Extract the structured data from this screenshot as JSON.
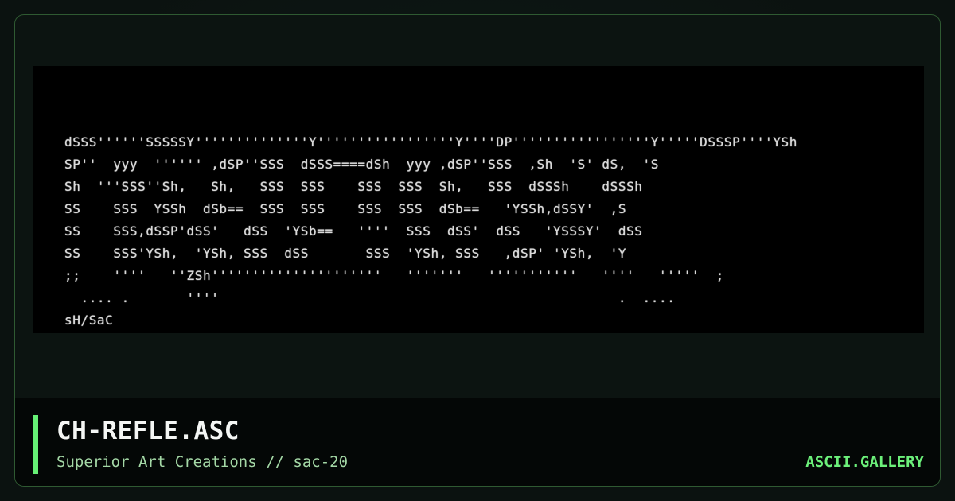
{
  "art": {
    "lines": [
      "dSSS''''''SSSSSY''''''''''''''Y'''''''''''''''''Y''''DP'''''''''''''''''Y'''''DSSSP''''YSh",
      "SP''  yyy  '''''' ,dSP''SSS  dSSS====dSh  yyy ,dSP''SSS  ,Sh  'S' dS,  'S",
      "Sh  '''SSS''Sh,   Sh,   SSS  SSS    SSS  SSS  Sh,   SSS  dSSSh    dSSSh",
      "SS    SSS  YSSh  dSb==  SSS  SSS    SSS  SSS  dSb==   'YSSh,dSSY'  ,S",
      "SS    SSS,dSSP'dSS'   dSS  'YSb==   ''''  SSS  dSS'  dSS   'YSSSY'  dSS",
      "SS    SSS'YSh,  'YSh, SSS  dSS       SSS  'YSh, SSS   ,dSP' 'YSh,  'Y",
      ";;    ''''   ''ZSh'''''''''''''''''''''   '''''''   '''''''''''   ''''   '''''  ;",
      "  .... .       ''''                                                 .  ....",
      "sH/SaC"
    ]
  },
  "footer": {
    "title": "CH-REFLE.ASC",
    "subtitle": "Superior Art Creations // sac-20",
    "brand": "ASCII.GALLERY"
  },
  "colors": {
    "accent": "#66f075",
    "brand": "#6cf07a",
    "frame_border": "#2f5a32",
    "art_background": "#000000"
  }
}
